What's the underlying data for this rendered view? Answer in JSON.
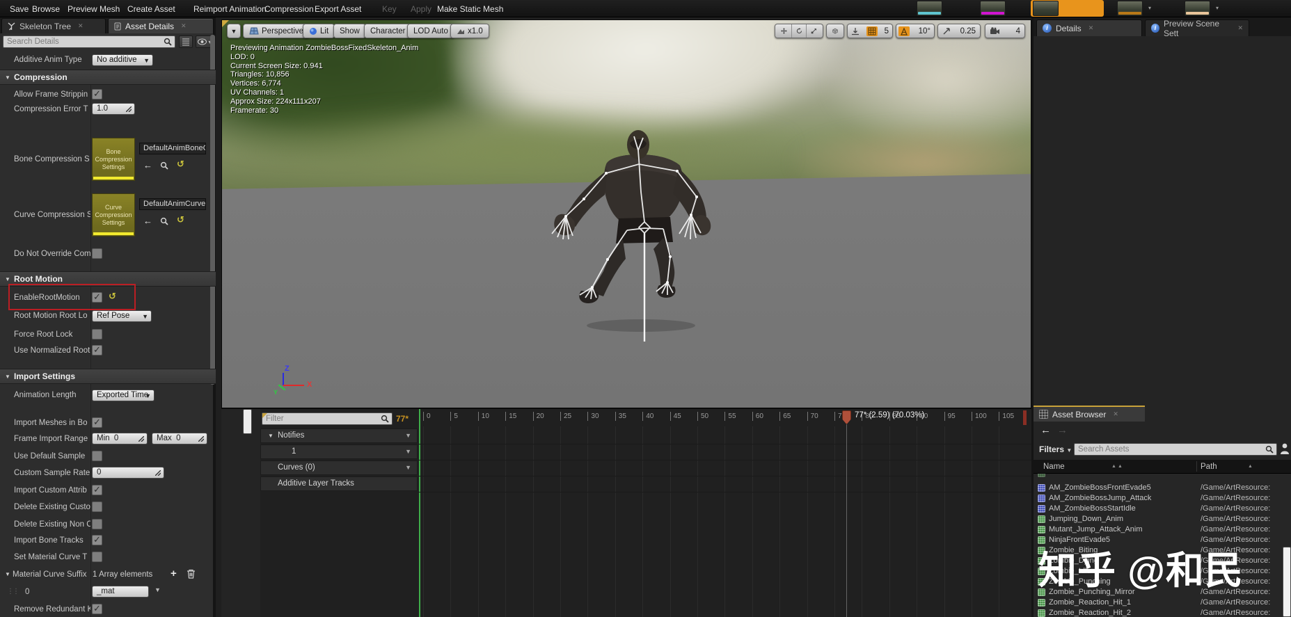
{
  "toolbar": {
    "items": [
      "Save",
      "Browse",
      "Preview Mesh",
      "Create Asset",
      "Reimport Animation",
      "Compression",
      "Export Asset",
      "Key",
      "Apply",
      "Make Static Mesh"
    ]
  },
  "left_panel": {
    "tabs": [
      {
        "label": "Skeleton Tree"
      },
      {
        "label": "Asset Details"
      }
    ],
    "search_placeholder": "Search Details",
    "sections": {
      "compression": "Compression",
      "root_motion": "Root Motion",
      "import_settings": "Import Settings"
    },
    "props": {
      "additive_anim_type": {
        "label": "Additive Anim Type",
        "value": "No additive"
      },
      "allow_frame_stripping": {
        "label": "Allow Frame Strippin"
      },
      "compression_error": {
        "label": "Compression Error T",
        "value": "1.0"
      },
      "bone_compression": {
        "label": "Bone Compression S",
        "thumb": "Bone Compression Settings",
        "value": "DefaultAnimBoneCompr"
      },
      "curve_compression": {
        "label": "Curve Compression S",
        "thumb": "Curve Compression Settings",
        "value": "DefaultAnimCurveComp"
      },
      "do_not_override": {
        "label": "Do Not Override Com"
      },
      "enable_root_motion": {
        "label": "EnableRootMotion"
      },
      "root_motion_root_lock": {
        "label": "Root Motion Root Lo",
        "value": "Ref Pose"
      },
      "force_root_lock": {
        "label": "Force Root Lock"
      },
      "use_normalized_root": {
        "label": "Use Normalized Root"
      },
      "animation_length": {
        "label": "Animation Length",
        "value": "Exported Time"
      },
      "import_meshes_in_bone": {
        "label": "Import Meshes in Bo"
      },
      "frame_import_range": {
        "label": "Frame Import Range",
        "min_label": "Min",
        "min_value": "0",
        "max_label": "Max",
        "max_value": "0"
      },
      "use_default_sample": {
        "label": "Use Default Sample"
      },
      "custom_sample_rate": {
        "label": "Custom Sample Rate",
        "value": "0"
      },
      "import_custom_attributes": {
        "label": "Import Custom Attrib"
      },
      "delete_existing_custom": {
        "label": "Delete Existing Custo"
      },
      "delete_existing_non": {
        "label": "Delete Existing Non C"
      },
      "import_bone_tracks": {
        "label": "Import Bone Tracks"
      },
      "set_material_curve": {
        "label": "Set Material Curve T"
      },
      "material_curve_suffix": {
        "label": "Material Curve Suffix",
        "value": "1 Array elements"
      },
      "material_curve_item": {
        "index": "0",
        "value": "_mat"
      },
      "remove_redundant": {
        "label": "Remove Redundant K"
      }
    }
  },
  "viewport": {
    "buttons": {
      "perspective": "Perspective",
      "lit": "Lit",
      "show": "Show",
      "character": "Character",
      "lod": "LOD Auto",
      "playback_speed": "x1.0"
    },
    "snap": {
      "grid_size": "5",
      "rotation_angle": "10°",
      "scale_size": "0.25",
      "camera_speed": "4"
    },
    "stats": [
      "Previewing Animation ZombieBossFixedSkeleton_Anim",
      "LOD: 0",
      "Current Screen Size: 0.941",
      "Triangles: 10,856",
      "Vertices: 6,774",
      "UV Channels: 1",
      "Approx Size: 224x111x207",
      "Framerate: 30"
    ],
    "axis": {
      "x": "X",
      "y": "Y",
      "z": "Z"
    }
  },
  "timeline": {
    "filter_placeholder": "Filter",
    "frame_badge": "77*",
    "playhead_label": "77* (2.59) (70.03%)",
    "playhead_frame": 77,
    "tracks": [
      {
        "label": "Notifies"
      },
      {
        "label": "1"
      },
      {
        "label": "Curves (0)"
      },
      {
        "label": "Additive Layer Tracks"
      }
    ],
    "ticks": [
      "0",
      "5",
      "10",
      "15",
      "20",
      "25",
      "30",
      "35",
      "40",
      "45",
      "50",
      "55",
      "60",
      "65",
      "70",
      "75",
      "80",
      "85",
      "90",
      "95",
      "100",
      "105"
    ]
  },
  "right_panel": {
    "tabs": [
      {
        "label": "Details"
      },
      {
        "label": "Preview Scene Sett"
      }
    ],
    "asset_browser": {
      "tab_label": "Asset Browser",
      "filters_label": "Filters",
      "search_placeholder": "Search Assets",
      "columns": {
        "name": "Name",
        "path": "Path"
      },
      "rows": [
        {
          "name": "AM_ZombieBossFrontEvade5",
          "path": "/Game/ArtResource:"
        },
        {
          "name": "AM_ZombieBossJump_Attack",
          "path": "/Game/ArtResource:"
        },
        {
          "name": "AM_ZombieBossStartIdle",
          "path": "/Game/ArtResource:"
        },
        {
          "name": "Jumping_Down_Anim",
          "path": "/Game/ArtResource:"
        },
        {
          "name": "Mutant_Jump_Attack_Anim",
          "path": "/Game/ArtResource:"
        },
        {
          "name": "NinjaFrontEvade5",
          "path": "/Game/ArtResource:"
        },
        {
          "name": "Zombie_Biting",
          "path": "/Game/ArtResource:"
        },
        {
          "name": "Zombie_Dying",
          "path": "/Game/ArtResource:"
        },
        {
          "name": "Zombie_Idle",
          "path": "/Game/ArtResource:"
        },
        {
          "name": "Zombie_Punching",
          "path": "/Game/ArtResource:"
        },
        {
          "name": "Zombie_Punching_Mirror",
          "path": "/Game/ArtResource:"
        },
        {
          "name": "Zombie_Reaction_Hit_1",
          "path": "/Game/ArtResource:"
        },
        {
          "name": "Zombie_Reaction_Hit_2",
          "path": "/Game/ArtResource:"
        }
      ]
    }
  },
  "watermark": "知乎 @和民",
  "colors": {
    "accent_orange": "#e8941c",
    "highlight_red": "#bb1e24",
    "thumb_yellow": "#f2ea2e",
    "timeline_green": "#3fae4a",
    "playhead_red": "#b0503a",
    "montage_icon_blue": "#3c49b4",
    "sequence_icon_green": "#3f8f3f"
  }
}
